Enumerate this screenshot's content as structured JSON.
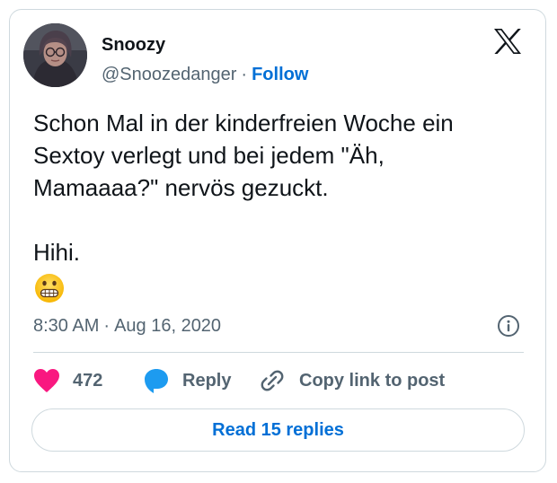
{
  "user": {
    "display_name": "Snoozy",
    "handle": "@Snoozedanger",
    "separator": "·",
    "follow_label": "Follow",
    "avatar_icon": "profile-avatar"
  },
  "tweet": {
    "text": "Schon Mal in der kinderfreien Woche ein\nSextoy verlegt und bei jedem \"Äh,\nMamaaaa?\" nervös gezuckt.\n\nHihi.",
    "emoji": "😬",
    "emoji_icon": "grimacing-face-emoji",
    "time": "8:30 AM",
    "separator": "·",
    "date": "Aug 16, 2020"
  },
  "actions": {
    "like_count": "472",
    "reply_label": "Reply",
    "copy_label": "Copy link to post"
  },
  "read_replies_label": "Read 15 replies",
  "icons": {
    "brand": "x-logo-icon",
    "info": "info-icon",
    "like": "heart-icon",
    "reply": "speech-bubble-icon",
    "copy": "link-icon"
  },
  "colors": {
    "text": "#0f1419",
    "secondary": "#536471",
    "link": "#006fd6",
    "heart": "#f91880",
    "reply_bubble": "#1d9bf0",
    "border": "#cfd9de"
  }
}
